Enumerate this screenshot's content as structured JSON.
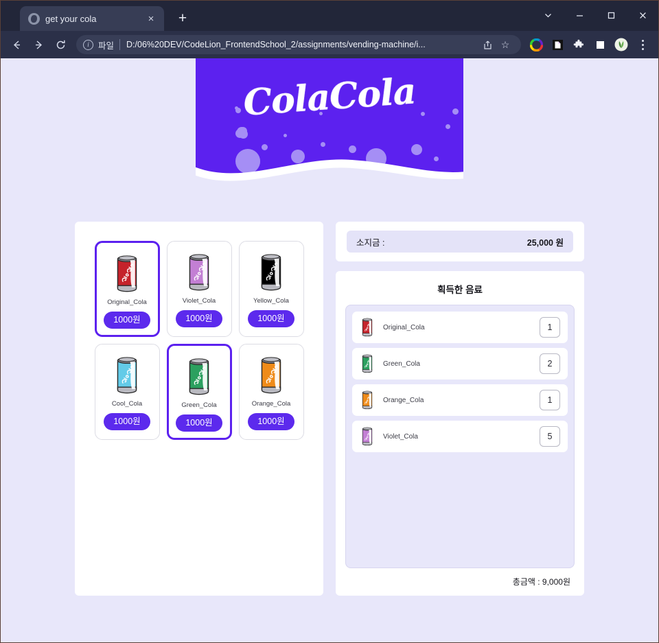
{
  "browser": {
    "tab_title": "get your cola",
    "tab_close_label": "×",
    "newtab_label": "+",
    "back_label": "←",
    "forward_label": "→",
    "reload_label": "⟳",
    "info_label": "i",
    "url_scheme_label": "파일",
    "url": "D:/06%20DEV/CodeLion_FrontendSchool_2/assignments/vending-machine/i...",
    "share_label": "share-icon",
    "bookmark_label": "☆",
    "window_minimize": "—",
    "window_maximize": "□",
    "window_close": "✕",
    "window_tabsearch": "⌄",
    "menu_label": "more-menu"
  },
  "banner": {
    "logo_text": "ColaCola",
    "bg_color": "#5c21ef",
    "bubble_color": "#a58ef5",
    "wave_color": "#ffffff"
  },
  "colors": {
    "page_bg": "#e8e7fa",
    "accent": "#5c2aed",
    "selected_border": "#5c21ef",
    "panel_bg": "#ffffff"
  },
  "machine": {
    "items": [
      {
        "name": "Original_Cola",
        "price_label": "1000원",
        "color": "#c5232b",
        "selected": true
      },
      {
        "name": "Violet_Cola",
        "price_label": "1000원",
        "color": "#c37fd4",
        "selected": false
      },
      {
        "name": "Yellow_Cola",
        "price_label": "1000원",
        "color": "#eec košt",
        "selected": false
      },
      {
        "name": "Cool_Cola",
        "price_label": "1000원",
        "color": "#63cbe8",
        "selected": false
      },
      {
        "name": "Green_Cola",
        "price_label": "1000원",
        "color": "#2ba05f",
        "selected": true
      },
      {
        "name": "Orange_Cola",
        "price_label": "1000원",
        "color": "#ef8b19",
        "selected": false
      }
    ]
  },
  "wallet": {
    "label": "소지금 :",
    "amount": "25,000 원"
  },
  "acquired": {
    "title": "획득한 음료",
    "rows": [
      {
        "name": "Original_Cola",
        "qty": "1",
        "color": "#c5232b"
      },
      {
        "name": "Green_Cola",
        "qty": "2",
        "color": "#2ba05f"
      },
      {
        "name": "Orange_Cola",
        "qty": "1",
        "color": "#ef8b19"
      },
      {
        "name": "Violet_Cola",
        "qty": "5",
        "color": "#c37fd4"
      }
    ],
    "total_label": "총금액 : 9,000원"
  }
}
